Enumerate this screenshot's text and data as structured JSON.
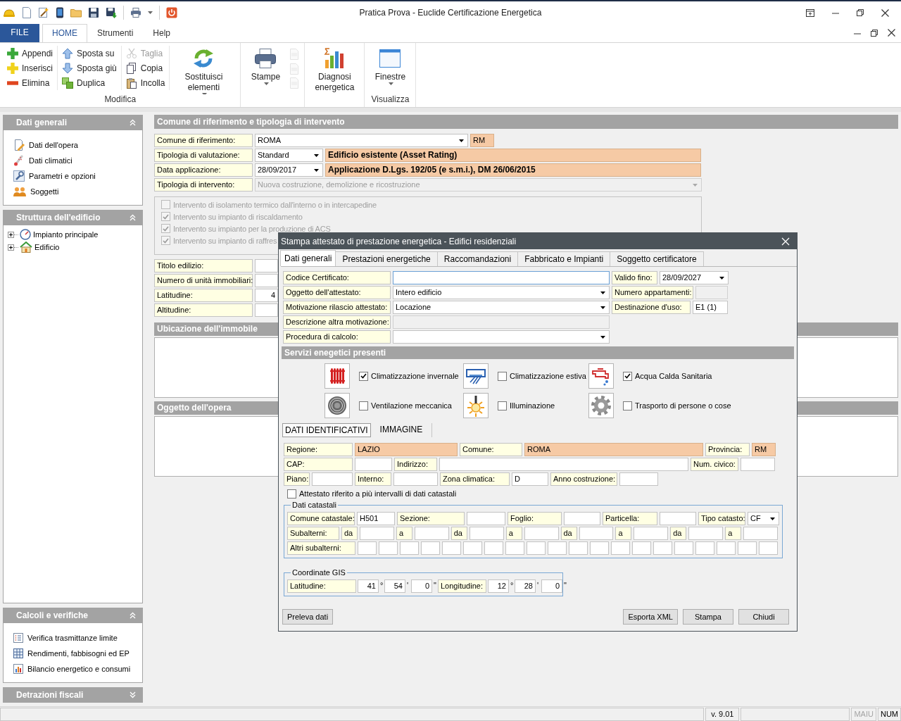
{
  "window": {
    "title": "Pratica Prova - Euclide Certificazione Energetica"
  },
  "ribbon": {
    "tabs": [
      {
        "label": "FILE",
        "kind": "file",
        "selected": false
      },
      {
        "label": "HOME",
        "kind": "tab",
        "selected": true
      },
      {
        "label": "Strumenti",
        "kind": "tab",
        "selected": false
      },
      {
        "label": "Help",
        "kind": "tab",
        "selected": false
      }
    ],
    "groups": [
      {
        "label": "Modifica",
        "items": [
          {
            "kind": "small",
            "label": "Appendi",
            "disabled": false
          },
          {
            "kind": "small",
            "label": "Inserisci",
            "disabled": false
          },
          {
            "kind": "small",
            "label": "Elimina",
            "disabled": false
          },
          {
            "kind": "small",
            "label": "Sposta su",
            "disabled": false
          },
          {
            "kind": "small",
            "label": "Sposta giù",
            "disabled": false
          },
          {
            "kind": "small",
            "label": "Duplica",
            "disabled": false
          },
          {
            "kind": "small",
            "label": "Taglia",
            "disabled": true
          },
          {
            "kind": "small",
            "label": "Copia",
            "disabled": false
          },
          {
            "kind": "small",
            "label": "Incolla",
            "disabled": false
          },
          {
            "kind": "large",
            "label": "Sostituisci elementi",
            "menu": true,
            "disabled": false
          }
        ]
      },
      {
        "items": [
          {
            "kind": "large",
            "label": "Stampe",
            "menu": true,
            "disabled": false
          },
          {
            "kind": "mini",
            "disabled": true
          },
          {
            "kind": "mini",
            "disabled": true
          },
          {
            "kind": "mini",
            "disabled": true
          }
        ]
      },
      {
        "items": [
          {
            "kind": "large",
            "label": "Diagnosi energetica",
            "menu": false,
            "disabled": false
          }
        ]
      },
      {
        "label": "Visualizza",
        "items": [
          {
            "kind": "large",
            "label": "Finestre",
            "menu": true,
            "disabled": false
          }
        ]
      }
    ]
  },
  "sidebar": {
    "panels": [
      {
        "title": "Dati generali",
        "expanded": true,
        "kind": "list",
        "items": [
          {
            "label": "Dati dell'opera"
          },
          {
            "label": "Dati climatici"
          },
          {
            "label": "Parametri e opzioni"
          },
          {
            "label": "Soggetti"
          }
        ]
      },
      {
        "title": "Struttura dell'edificio",
        "expanded": true,
        "kind": "tree",
        "items": [
          {
            "label": "Impianto principale",
            "expanded": false
          },
          {
            "label": "Edificio",
            "expanded": false
          }
        ]
      },
      {
        "title": "Calcoli e verifiche",
        "expanded": true,
        "kind": "list",
        "items": [
          {
            "label": "Verifica trasmittanze limite"
          },
          {
            "label": "Rendimenti, fabbisogni ed EP"
          },
          {
            "label": "Bilancio energetico e consumi"
          }
        ]
      },
      {
        "title": "Detrazioni fiscali",
        "expanded": false
      }
    ]
  },
  "main": {
    "title": "Comune di riferimento e tipologia di intervento",
    "top_rows": [
      [
        {
          "kind": "label",
          "text": "Comune di riferimento:"
        },
        {
          "kind": "combo",
          "value": "ROMA"
        },
        {
          "kind": "highlight",
          "text": "RM"
        }
      ],
      [
        {
          "kind": "label",
          "text": "Tipologia di valutazione:"
        },
        {
          "kind": "combo",
          "value": "Standard"
        },
        {
          "kind": "banner",
          "text": "Edificio esistente (Asset Rating)"
        }
      ],
      [
        {
          "kind": "label",
          "text": "Data applicazione:"
        },
        {
          "kind": "combo",
          "value": "28/09/2017"
        },
        {
          "kind": "banner",
          "text": "Applicazione D.Lgs. 192/05 (e s.m.i.), DM 26/06/2015"
        }
      ],
      [
        {
          "kind": "label",
          "text": "Tipologia di intervento:"
        },
        {
          "kind": "disabledcombo",
          "value": "Nuova costruzione, demolizione e ricostruzione"
        }
      ]
    ],
    "interventions": {
      "disabled": true,
      "items": [
        {
          "label": "Intervento di isolamento termico dall'interno o in intercapedine",
          "checked": false
        },
        {
          "label": "Intervento su impianto di riscaldamento",
          "checked": true
        },
        {
          "label": "Intervento su impianto per la produzione di ACS",
          "checked": true
        },
        {
          "label": "Intervento su impianto di raffres",
          "checked": true
        }
      ]
    },
    "detail_rows": [
      [
        {
          "kind": "label",
          "text": "Titolo edilizio:"
        },
        {
          "kind": "input"
        }
      ],
      [
        {
          "kind": "label",
          "text": "Numero di unità immobiliari:"
        },
        {
          "kind": "input"
        }
      ],
      [
        {
          "kind": "label",
          "text": "Latitudine:"
        },
        {
          "kind": "number",
          "value": "4"
        }
      ],
      [
        {
          "kind": "label",
          "text": "Altitudine:"
        },
        {
          "kind": "input"
        }
      ]
    ],
    "sections": [
      {
        "title": "Ubicazione dell'immobile"
      },
      {
        "title": "Oggetto dell'opera"
      }
    ]
  },
  "dialog": {
    "title": "Stampa attestato di prestazione energetica - Edifici residenziali",
    "tabs": [
      {
        "label": "Dati generali",
        "selected": true
      },
      {
        "label": "Prestazioni energetiche",
        "selected": false
      },
      {
        "label": "Raccomandazioni",
        "selected": false
      },
      {
        "label": "Fabbricato e Impianti",
        "selected": false
      },
      {
        "label": "Soggetto certificatore",
        "selected": false
      }
    ],
    "rows": [
      [
        {
          "kind": "label",
          "text": "Codice Certificato:"
        },
        {
          "kind": "focus"
        },
        {
          "kind": "label",
          "text": "Valido fino:"
        },
        {
          "kind": "combo",
          "value": "28/09/2027"
        }
      ],
      [
        {
          "kind": "label",
          "text": "Oggetto dell'attestato:"
        },
        {
          "kind": "combo",
          "value": "Intero edificio"
        },
        {
          "kind": "label",
          "text": "Numero appartamenti:"
        },
        {
          "kind": "disabled"
        }
      ],
      [
        {
          "kind": "label",
          "text": "Motivazione rilascio attestato:"
        },
        {
          "kind": "combo",
          "value": "Locazione"
        },
        {
          "kind": "label",
          "text": "Destinazione d'uso:"
        },
        {
          "kind": "input",
          "value": "E1 (1)"
        }
      ],
      [
        {
          "kind": "label",
          "text": "Descrizione altra motivazione:"
        },
        {
          "kind": "disabled"
        }
      ],
      [
        {
          "kind": "label",
          "text": "Procedura di calcolo:"
        },
        {
          "kind": "combo"
        }
      ]
    ],
    "services_title": "Servizi enegetici presenti",
    "services": [
      {
        "label": "Climatizzazione invernale",
        "checked": true
      },
      {
        "label": "Climatizzazione estiva",
        "checked": false
      },
      {
        "label": "Acqua Calda Sanitaria",
        "checked": true
      },
      {
        "label": "Ventilazione meccanica",
        "checked": false
      },
      {
        "label": "Illuminazione",
        "checked": false
      },
      {
        "label": "Trasporto di persone o cose",
        "checked": false
      }
    ],
    "subtabs": [
      {
        "label": "DATI IDENTIFICATIVI",
        "selected": true
      },
      {
        "label": "IMMAGINE",
        "selected": false
      }
    ],
    "location_rows": [
      [
        {
          "kind": "label",
          "text": "Regione:"
        },
        {
          "kind": "highlight",
          "text": "LAZIO"
        },
        {
          "kind": "label",
          "text": "Comune:"
        },
        {
          "kind": "highlight",
          "text": "ROMA"
        },
        {
          "kind": "label",
          "text": "Provincia:"
        },
        {
          "kind": "highlight",
          "text": "RM"
        }
      ],
      [
        {
          "kind": "label",
          "text": "CAP:"
        },
        {
          "kind": "input"
        },
        {
          "kind": "label",
          "text": "Indirizzo:"
        },
        {
          "kind": "input"
        },
        {
          "kind": "label",
          "text": "Num. civico:"
        },
        {
          "kind": "input"
        }
      ],
      [
        {
          "kind": "label",
          "text": "Piano:"
        },
        {
          "kind": "input"
        },
        {
          "kind": "label",
          "text": "Interno:"
        },
        {
          "kind": "input"
        },
        {
          "kind": "label",
          "text": "Zona climatica:"
        },
        {
          "kind": "input",
          "value": "D"
        },
        {
          "kind": "label",
          "text": "Anno costruzione:"
        },
        {
          "kind": "input"
        }
      ]
    ],
    "multi_check": {
      "label": "Attestato riferito a più intervalli di dati catastali",
      "checked": false
    },
    "cadastre": {
      "title": "Dati catastali",
      "rows": [
        [
          {
            "kind": "label",
            "text": "Comune catastale:"
          },
          {
            "kind": "input",
            "value": "H501"
          },
          {
            "kind": "label",
            "text": "Sezione:"
          },
          {
            "kind": "input"
          },
          {
            "kind": "label",
            "text": "Foglio:"
          },
          {
            "kind": "input"
          },
          {
            "kind": "label",
            "text": "Particella:"
          },
          {
            "kind": "input"
          },
          {
            "kind": "label",
            "text": "Tipo catasto:"
          },
          {
            "kind": "combo",
            "value": "CF"
          }
        ],
        [
          {
            "kind": "label",
            "text": "Subalterni:"
          },
          {
            "kind": "label",
            "text": "da"
          },
          {
            "kind": "input"
          },
          {
            "kind": "label",
            "text": "a"
          },
          {
            "kind": "input"
          },
          {
            "kind": "label",
            "text": "da"
          },
          {
            "kind": "input"
          },
          {
            "kind": "label",
            "text": "a"
          },
          {
            "kind": "input"
          },
          {
            "kind": "label",
            "text": "da"
          },
          {
            "kind": "input"
          },
          {
            "kind": "label",
            "text": "a"
          },
          {
            "kind": "input"
          },
          {
            "kind": "label",
            "text": "da"
          },
          {
            "kind": "input"
          },
          {
            "kind": "label",
            "text": "a"
          },
          {
            "kind": "input"
          }
        ],
        [
          {
            "kind": "label",
            "text": "Altri subalterni:"
          },
          {
            "kind": "input"
          },
          {
            "kind": "input"
          },
          {
            "kind": "input"
          },
          {
            "kind": "input"
          },
          {
            "kind": "input"
          },
          {
            "kind": "input"
          },
          {
            "kind": "input"
          },
          {
            "kind": "input"
          },
          {
            "kind": "input"
          },
          {
            "kind": "input"
          },
          {
            "kind": "input"
          },
          {
            "kind": "input"
          },
          {
            "kind": "input"
          },
          {
            "kind": "input"
          },
          {
            "kind": "input"
          },
          {
            "kind": "input"
          },
          {
            "kind": "input"
          },
          {
            "kind": "input"
          },
          {
            "kind": "input"
          },
          {
            "kind": "input"
          }
        ]
      ]
    },
    "gis": {
      "title": "Coordinate GIS",
      "rows": [
        [
          {
            "kind": "label",
            "text": "Latitudine:"
          },
          {
            "kind": "number",
            "value": "41"
          },
          {
            "kind": "unit",
            "text": "°"
          },
          {
            "kind": "number",
            "value": "54"
          },
          {
            "kind": "unit",
            "text": "'"
          },
          {
            "kind": "number",
            "value": "0"
          },
          {
            "kind": "unit",
            "text": "\""
          },
          {
            "kind": "label",
            "text": "Longitudine:"
          },
          {
            "kind": "number",
            "value": "12"
          },
          {
            "kind": "unit",
            "text": "°"
          },
          {
            "kind": "number",
            "value": "28"
          },
          {
            "kind": "unit",
            "text": "'"
          },
          {
            "kind": "number",
            "value": "0"
          },
          {
            "kind": "unit",
            "text": "\""
          }
        ]
      ]
    },
    "buttons": [
      {
        "label": "Preleva dati"
      },
      {
        "label": "Esporta XML"
      },
      {
        "label": "Stampa"
      },
      {
        "label": "Chiudi"
      }
    ]
  },
  "status_bar": [
    {
      "kind": "blank"
    },
    {
      "kind": "text",
      "text": "v. 9.01"
    },
    {
      "kind": "blank"
    },
    {
      "kind": "key",
      "text": "MAIU",
      "on": false
    },
    {
      "kind": "key",
      "text": "NUM",
      "on": true
    }
  ]
}
